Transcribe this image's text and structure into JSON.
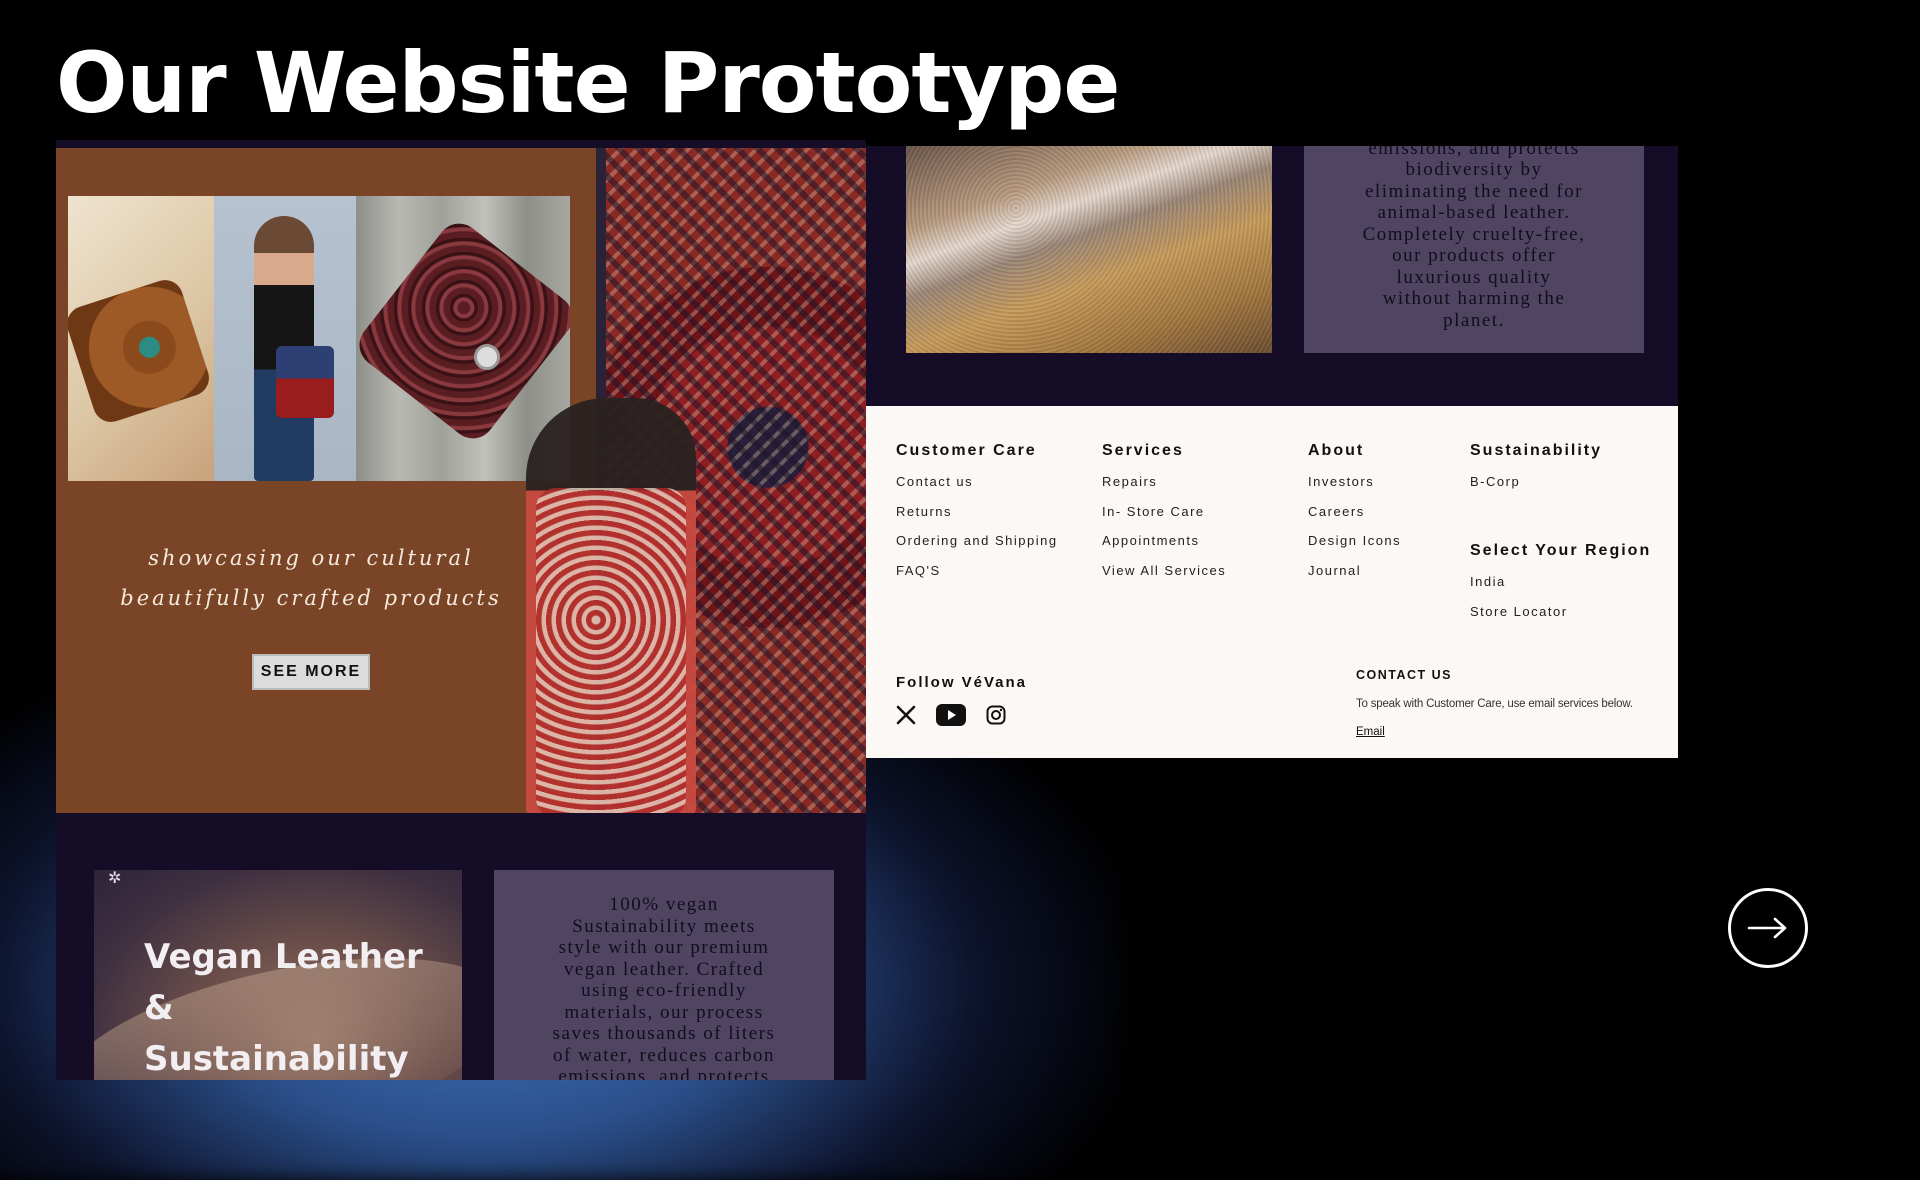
{
  "slide": {
    "title": "Our Website Prototype"
  },
  "hero": {
    "tagline_line1": "showcasing our cultural",
    "tagline_line2": "beautifully crafted products",
    "see_more_label": "SEE MORE"
  },
  "vegan": {
    "title": "Vegan Leather & Sustainability",
    "body_lines": [
      "100% vegan",
      "Sustainability meets",
      "style with our premium",
      "vegan leather. Crafted",
      "using eco-friendly",
      "materials, our process",
      "saves thousands of liters",
      "of water, reduces carbon",
      "emissions, and protects"
    ],
    "continued_lines": [
      "emissions, and protects",
      "biodiversity by",
      "eliminating the need for",
      "animal-based leather.",
      "Completely cruelty-free,",
      "our products offer",
      "luxurious quality",
      "without harming the",
      "planet."
    ]
  },
  "footer": {
    "customer_care": {
      "title": "Customer Care",
      "links": [
        "Contact us",
        "Returns",
        "Ordering and Shipping",
        "FAQ'S"
      ]
    },
    "services": {
      "title": "Services",
      "links": [
        "Repairs",
        "In- Store Care",
        "Appointments",
        "View All Services"
      ]
    },
    "about": {
      "title": "About",
      "links": [
        "Investors",
        "Careers",
        "Design Icons",
        "Journal"
      ]
    },
    "sustainability": {
      "title": "Sustainability",
      "links": [
        "B-Corp"
      ]
    },
    "region": {
      "title": "Select Your Region",
      "links": [
        "India",
        "Store Locator"
      ]
    },
    "follow_title": "Follow VéVana",
    "socials": [
      "x-icon",
      "youtube-icon",
      "instagram-icon"
    ],
    "contact": {
      "title": "CONTACT US",
      "text": "To speak with Customer Care, use email services below.",
      "email_label": "Email"
    }
  },
  "navigation": {
    "next_icon": "arrow-right-icon"
  },
  "colors": {
    "panel_bg": "#150c27",
    "hero_bg": "#7a4526",
    "card_bg": "#4f4462",
    "footer_bg": "#fcf8f6"
  }
}
